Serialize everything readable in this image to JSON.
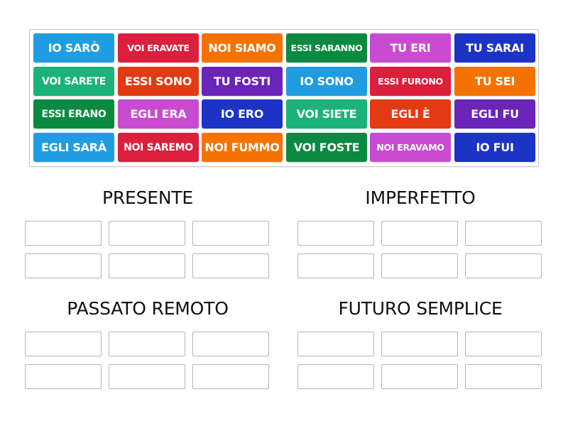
{
  "tiles": [
    {
      "label": "IO SARÒ",
      "color": "#1f9de0"
    },
    {
      "label": "VOI ERAVATE",
      "color": "#dc1f3d"
    },
    {
      "label": "NOI SIAMO",
      "color": "#f47300"
    },
    {
      "label": "ESSI SARANNO",
      "color": "#0a8a40"
    },
    {
      "label": "TU ERI",
      "color": "#c84bd1"
    },
    {
      "label": "TU SARAI",
      "color": "#1d33c6"
    },
    {
      "label": "VOI SARETE",
      "color": "#1bb27b"
    },
    {
      "label": "ESSI SONO",
      "color": "#e23a13"
    },
    {
      "label": "TU FOSTI",
      "color": "#6a24b7"
    },
    {
      "label": "IO SONO",
      "color": "#1f9de0"
    },
    {
      "label": "ESSI FURONO",
      "color": "#dc1f3d"
    },
    {
      "label": "TU SEI",
      "color": "#f47300"
    },
    {
      "label": "ESSI ERANO",
      "color": "#0a8a40"
    },
    {
      "label": "EGLI ERA",
      "color": "#c84bd1"
    },
    {
      "label": "IO ERO",
      "color": "#1d33c6"
    },
    {
      "label": "VOI SIETE",
      "color": "#1bb27b"
    },
    {
      "label": "EGLI È",
      "color": "#e23a13"
    },
    {
      "label": "EGLI FU",
      "color": "#6a24b7"
    },
    {
      "label": "EGLI SARÀ",
      "color": "#1f9de0"
    },
    {
      "label": "NOI SAREMO",
      "color": "#dc1f3d"
    },
    {
      "label": "NOI FUMMO",
      "color": "#f47300"
    },
    {
      "label": "VOI FOSTE",
      "color": "#0a8a40"
    },
    {
      "label": "NOI ERAVAMO",
      "color": "#c84bd1"
    },
    {
      "label": "IO FUI",
      "color": "#1d33c6"
    }
  ],
  "groups": [
    {
      "title": "PRESENTE",
      "slots": 6
    },
    {
      "title": "IMPERFETTO",
      "slots": 6
    },
    {
      "title": "PASSATO REMOTO",
      "slots": 6
    },
    {
      "title": "FUTURO SEMPLICE",
      "slots": 6
    }
  ]
}
